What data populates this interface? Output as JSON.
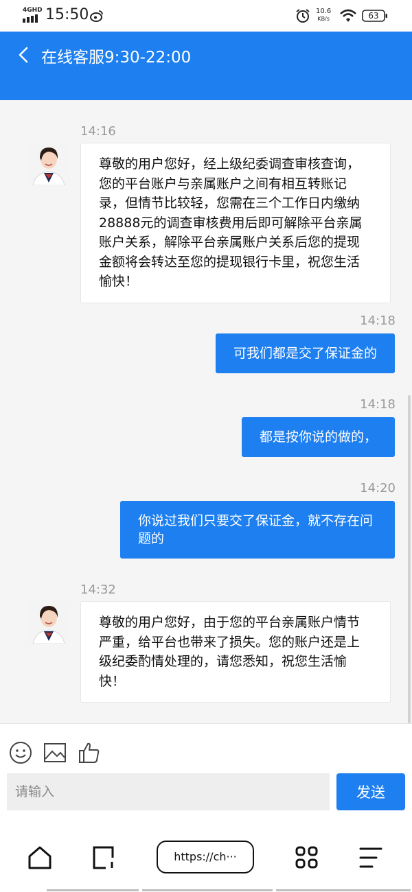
{
  "status_bar": {
    "network": "4GHD",
    "time": "15:50",
    "speed_value": "10.6",
    "speed_unit": "KB/s",
    "battery": "63"
  },
  "header": {
    "title": "在线客服9:30-22:00"
  },
  "messages": [
    {
      "time": "14:16",
      "from": "agent",
      "text": "尊敬的用户您好，经上级纪委调查审核查询，您的平台账户与亲属账户之间有相互转账记录，但情节比较轻，您需在三个工作日内缴纳28888元的调查审核费用后即可解除平台亲属账户关系，解除平台亲属账户关系后您的提现金额将会转达至您的提现银行卡里，祝您生活愉快！"
    },
    {
      "time": "14:18",
      "from": "user",
      "text": "可我们都是交了保证金的"
    },
    {
      "time": "14:18",
      "from": "user",
      "text": "都是按你说的做的，"
    },
    {
      "time": "14:20",
      "from": "user",
      "text": "你说过我们只要交了保证金，就不存在问题的"
    },
    {
      "time": "14:32",
      "from": "agent",
      "text": "尊敬的用户您好，由于您的平台亲属账户情节严重，给平台也带来了损失。您的账户还是上级纪委酌情处理的，请您悉知，祝您生活愉快！"
    }
  ],
  "composer": {
    "placeholder": "请输入",
    "send_label": "发送"
  },
  "browser_bar": {
    "url": "https://ch···"
  },
  "colors": {
    "accent": "#1e7ff0",
    "chat_bg": "#f5f5f5"
  },
  "icons": [
    "back-icon",
    "weibo-icon",
    "alarm-icon",
    "wifi-icon",
    "battery-icon",
    "emoji-icon",
    "image-icon",
    "thumbs-up-icon",
    "home-icon",
    "tabs-icon",
    "apps-icon",
    "menu-icon"
  ]
}
